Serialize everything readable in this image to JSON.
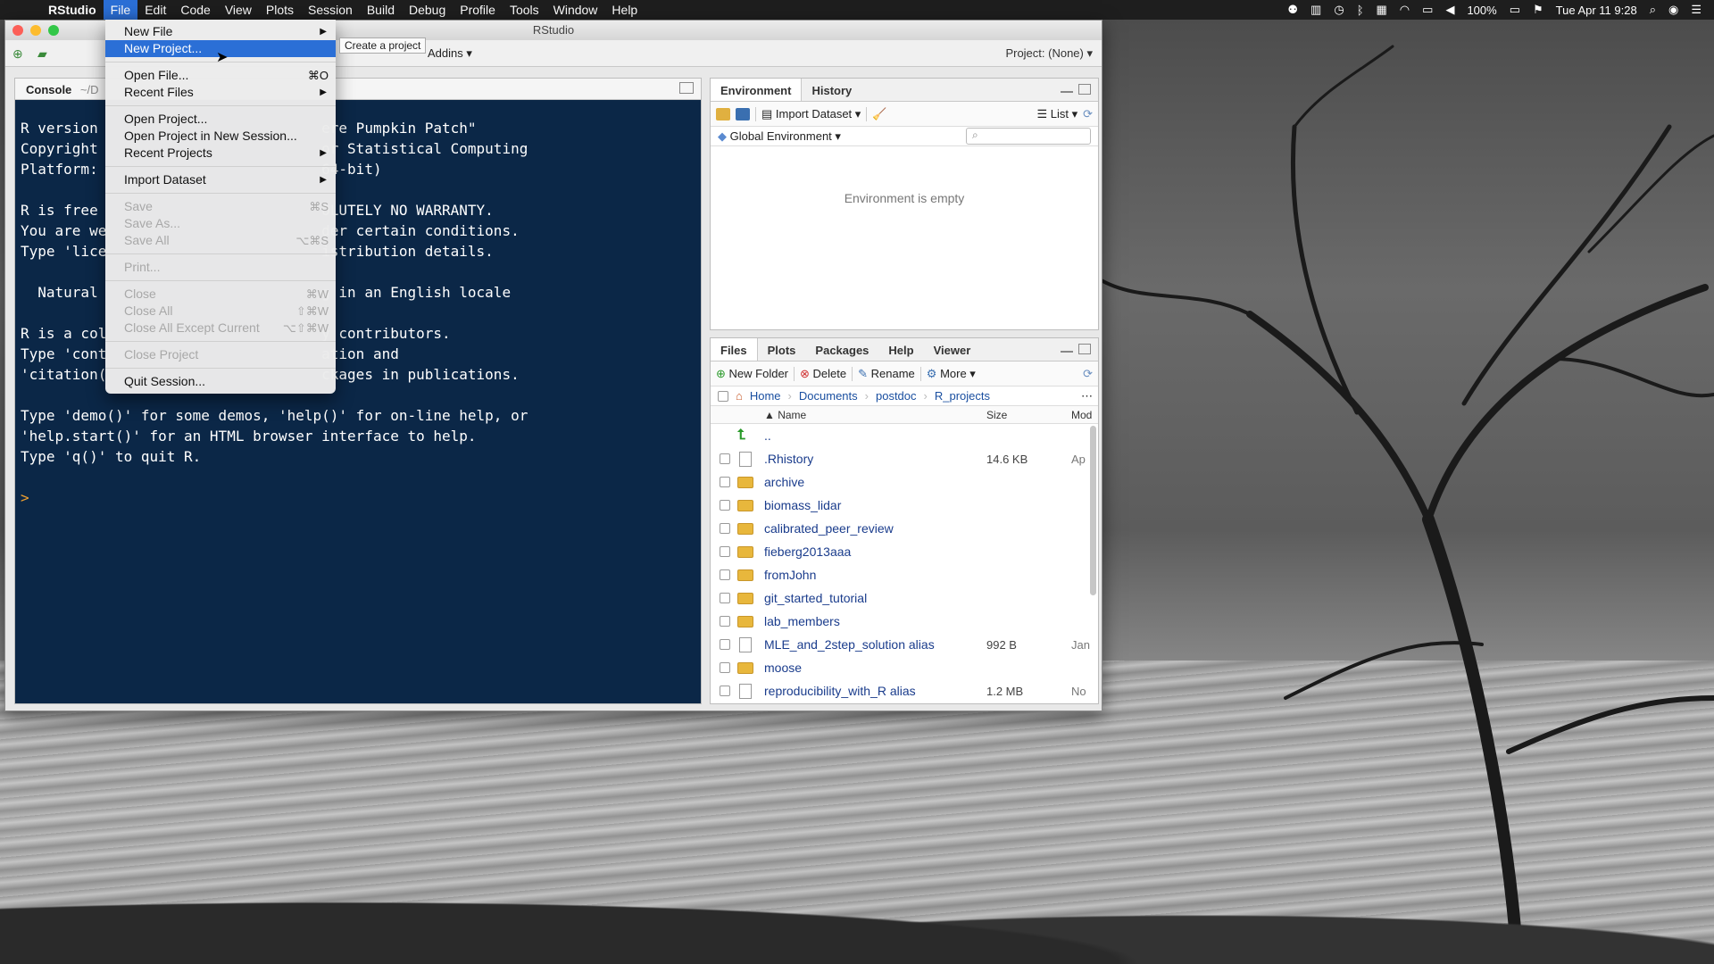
{
  "menubar": {
    "app": "RStudio",
    "items": [
      "File",
      "Edit",
      "Code",
      "View",
      "Plots",
      "Session",
      "Build",
      "Debug",
      "Profile",
      "Tools",
      "Window",
      "Help"
    ],
    "battery": "100%",
    "datetime": "Tue Apr 11  9:28"
  },
  "window": {
    "title": "RStudio"
  },
  "toolbar": {
    "addins": "Addins",
    "project": "Project: (None)"
  },
  "console": {
    "tab": "Console",
    "path": "~/D",
    "lines": [
      "R version                          ere Pumpkin Patch\"",
      "Copyright                          or Statistical Computing",
      "Platform:                          64-bit)",
      "",
      "R is free                          OLUTELY NO WARRANTY.",
      "You are we                         der certain conditions.",
      "Type 'lice                         istribution details.",
      "",
      "  Natural                          g in an English locale",
      "",
      "R is a col                         y contributors.",
      "Type 'cont                         ation and",
      "'citation(                         ckages in publications.",
      "",
      "Type 'demo()' for some demos, 'help()' for on-line help, or",
      "'help.start()' for an HTML browser interface to help.",
      "Type 'q()' to quit R.",
      ""
    ],
    "prompt": ">"
  },
  "file_menu": {
    "items": [
      {
        "label": "New File",
        "submenu": true
      },
      {
        "label": "New Project...",
        "highlighted": true
      },
      {
        "divider": true
      },
      {
        "label": "Open File...",
        "shortcut": "⌘O"
      },
      {
        "label": "Recent Files",
        "submenu": true
      },
      {
        "divider": true
      },
      {
        "label": "Open Project..."
      },
      {
        "label": "Open Project in New Session..."
      },
      {
        "label": "Recent Projects",
        "submenu": true
      },
      {
        "divider": true
      },
      {
        "label": "Import Dataset",
        "submenu": true
      },
      {
        "divider": true
      },
      {
        "label": "Save",
        "shortcut": "⌘S",
        "disabled": true
      },
      {
        "label": "Save As...",
        "disabled": true
      },
      {
        "label": "Save All",
        "shortcut": "⌥⌘S",
        "disabled": true
      },
      {
        "divider": true
      },
      {
        "label": "Print...",
        "disabled": true
      },
      {
        "divider": true
      },
      {
        "label": "Close",
        "shortcut": "⌘W",
        "disabled": true
      },
      {
        "label": "Close All",
        "shortcut": "⇧⌘W",
        "disabled": true
      },
      {
        "label": "Close All Except Current",
        "shortcut": "⌥⇧⌘W",
        "disabled": true
      },
      {
        "divider": true
      },
      {
        "label": "Close Project",
        "disabled": true
      },
      {
        "divider": true
      },
      {
        "label": "Quit Session..."
      }
    ],
    "tooltip": "Create a project"
  },
  "environment": {
    "tabs": [
      "Environment",
      "History"
    ],
    "import_dataset": "Import Dataset",
    "list": "List",
    "scope": "Global Environment",
    "empty_message": "Environment is empty"
  },
  "files": {
    "tabs": [
      "Files",
      "Plots",
      "Packages",
      "Help",
      "Viewer"
    ],
    "toolbar": {
      "new_folder": "New Folder",
      "delete": "Delete",
      "rename": "Rename",
      "more": "More"
    },
    "breadcrumb": [
      "Home",
      "Documents",
      "postdoc",
      "R_projects"
    ],
    "columns": {
      "name": "Name",
      "size": "Size",
      "modified": "Mod"
    },
    "rows": [
      {
        "name": "..",
        "type": "up",
        "size": "",
        "modified": ""
      },
      {
        "name": ".Rhistory",
        "type": "history",
        "size": "14.6 KB",
        "modified": "Ap"
      },
      {
        "name": "archive",
        "type": "folder",
        "size": "",
        "modified": ""
      },
      {
        "name": "biomass_lidar",
        "type": "folder",
        "size": "",
        "modified": ""
      },
      {
        "name": "calibrated_peer_review",
        "type": "folder",
        "size": "",
        "modified": ""
      },
      {
        "name": "fieberg2013aaa",
        "type": "folder",
        "size": "",
        "modified": ""
      },
      {
        "name": "fromJohn",
        "type": "folder",
        "size": "",
        "modified": ""
      },
      {
        "name": "git_started_tutorial",
        "type": "folder",
        "size": "",
        "modified": ""
      },
      {
        "name": "lab_members",
        "type": "folder",
        "size": "",
        "modified": ""
      },
      {
        "name": "MLE_and_2step_solution alias",
        "type": "file",
        "size": "992 B",
        "modified": "Jan"
      },
      {
        "name": "moose",
        "type": "folder",
        "size": "",
        "modified": ""
      },
      {
        "name": "reproducibility_with_R alias",
        "type": "file",
        "size": "1.2 MB",
        "modified": "No"
      }
    ]
  }
}
